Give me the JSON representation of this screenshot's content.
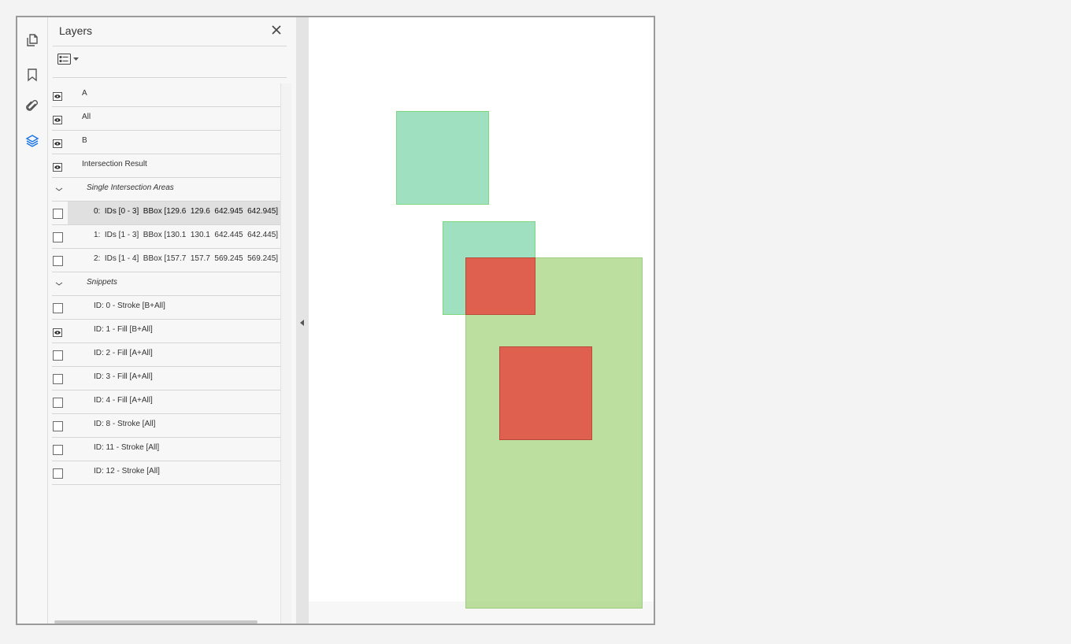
{
  "panel": {
    "title": "Layers",
    "close_icon": "close-icon",
    "options_icon": "layer-options-icon"
  },
  "rail": {
    "icons": [
      "pages-icon",
      "bookmark-icon",
      "attachment-icon",
      "layers-icon"
    ],
    "active": "layers-icon",
    "active_color": "#1473e6"
  },
  "layers": {
    "row_a": "A",
    "row_all": "All",
    "row_b": "B",
    "row_intersection": "Intersection Result",
    "group_single": "Single Intersection Areas",
    "single_0": "0:  IDs [0 - 3]  BBox [129.6  129.6  642.945  642.945]",
    "single_1": "1:  IDs [1 - 3]  BBox [130.1  130.1  642.445  642.445]",
    "single_2": "2:  IDs [1 - 4]  BBox [157.7  157.7  569.245  569.245]",
    "group_snippets": "Snippets",
    "snip_0": "ID: 0 - Stroke [B+All]",
    "snip_1": "ID: 1 - Fill [B+All]",
    "snip_2": "ID: 2 - Fill [A+All]",
    "snip_3": "ID: 3 - Fill [A+All]",
    "snip_4": "ID: 4 - Fill [A+All]",
    "snip_8": "ID: 8 - Stroke [All]",
    "snip_11": "ID: 11 - Stroke [All]",
    "snip_12": "ID: 12 - Stroke [All]"
  },
  "colors": {
    "teal_fill": "#9ee0c0",
    "teal_border": "#7fd87f",
    "red_fill": "#e06050",
    "red_border": "#b84a3a",
    "green_fill": "#bfdf9f",
    "green_border": "#9ccf80"
  }
}
